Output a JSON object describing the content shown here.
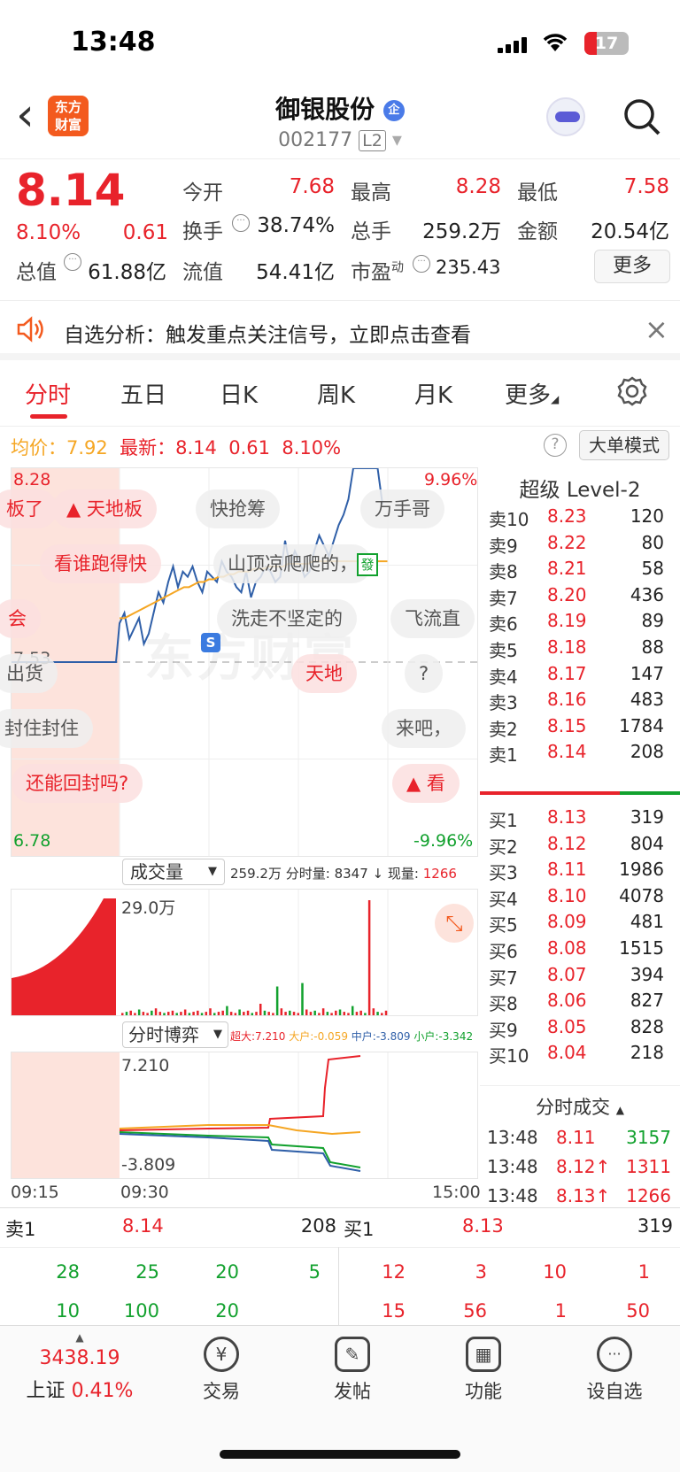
{
  "status": {
    "time": "13:48",
    "battery": "17"
  },
  "header": {
    "back": "‹",
    "logo_line1": "东方",
    "logo_line2": "财富",
    "title": "御银股份",
    "badge": "企",
    "code": "002177",
    "level": "L2",
    "dropdown": "▾"
  },
  "quote": {
    "price": "8.14",
    "pct": "8.10%",
    "chg": "0.61",
    "open_label": "今开",
    "open": "7.68",
    "high_label": "最高",
    "high": "8.28",
    "low_label": "最低",
    "low": "7.58",
    "turnover_label": "换手",
    "turnover": "38.74%",
    "vol_label": "总手",
    "vol": "259.2万",
    "amount_label": "金额",
    "amount": "20.54亿",
    "mcap_label": "总值",
    "mcap": "61.88亿",
    "float_label": "流值",
    "float": "54.41亿",
    "pe_label": "市盈",
    "pe_sup": "动",
    "pe": "235.43",
    "more": "更多"
  },
  "banner": {
    "text": "自选分析：触发重点关注信号，立即点击查看",
    "close": "×"
  },
  "tabs": [
    "分时",
    "五日",
    "日K",
    "周K",
    "月K",
    "更多"
  ],
  "chart": {
    "avg_label": "均价：",
    "avg": "7.92",
    "last_label": "最新：",
    "last": "8.14",
    "last_chg": "0.61",
    "last_pct": "8.10%",
    "mode": "大单模式",
    "help": "?",
    "y_top": "8.28",
    "y_mid": "7.53",
    "y_bot": "6.78",
    "pct_top": "9.96%",
    "pct_bot": "-9.96%",
    "watermark": "东方财富",
    "bubbles": [
      "板了",
      "天地板",
      "快抢筹",
      "万手哥",
      "看谁跑得快",
      "山顶凉爬爬的，",
      "会",
      "洗走不坚定的",
      "飞流直",
      "出货",
      "天地",
      "?",
      "封住封住",
      "来吧，",
      "还能回封吗?",
      "看"
    ],
    "fa": "發",
    "s_marker": "S"
  },
  "volume": {
    "selector": "成交量",
    "total": "259.2万",
    "min_label": "分时量:",
    "min_val": "8347",
    "arrow": "↓",
    "now_label": "现量:",
    "now_val": "1266",
    "scale": "29.0万"
  },
  "game": {
    "selector": "分时博弈",
    "super_label": "超大:",
    "super": "7.210",
    "big_label": "大户:",
    "big": "-0.059",
    "mid_label": "中户:",
    "mid": "-3.809",
    "small_label": "小户:",
    "small": "-3.342",
    "ytop": "7.210",
    "ybot": "-3.809"
  },
  "time_axis": [
    "09:15",
    "09:30",
    "15:00"
  ],
  "chart_data": {
    "type": "line",
    "title": "",
    "ylim": [
      6.78,
      8.28
    ],
    "prev_close": 7.53,
    "series": [
      {
        "name": "最新",
        "values": [
          7.53,
          7.53,
          7.53,
          7.53,
          7.53,
          7.53,
          7.53,
          7.53,
          7.53,
          7.53,
          7.53,
          7.53,
          7.53,
          7.53,
          7.53,
          7.53,
          7.53,
          7.53,
          7.53,
          7.53,
          7.53,
          7.53,
          7.53,
          7.68,
          7.72,
          7.62,
          7.66,
          7.7,
          7.6,
          7.64,
          7.72,
          7.8,
          7.76,
          7.84,
          7.9,
          7.82,
          7.88,
          7.86,
          7.9,
          7.84,
          7.8,
          7.88,
          7.86,
          7.84,
          7.92,
          7.88,
          7.86,
          7.82,
          7.8,
          7.88,
          7.78,
          7.84,
          7.86,
          7.9,
          7.88,
          7.84,
          7.86,
          8.0,
          7.9,
          7.96,
          7.92,
          7.86,
          7.88,
          7.96,
          8.02,
          7.98,
          7.94,
          8.0,
          8.06,
          8.1,
          8.16,
          8.28,
          8.28,
          8.28,
          8.28,
          8.28,
          8.28,
          8.14
        ]
      },
      {
        "name": "均价",
        "values": [
          7.7,
          7.7,
          7.71,
          7.72,
          7.73,
          7.74,
          7.75,
          7.76,
          7.77,
          7.78,
          7.79,
          7.8,
          7.81,
          7.82,
          7.82,
          7.83,
          7.84,
          7.84,
          7.85,
          7.85,
          7.86,
          7.86,
          7.87,
          7.87,
          7.88,
          7.88,
          7.88,
          7.89,
          7.89,
          7.89,
          7.9,
          7.9,
          7.9,
          7.9,
          7.91,
          7.91,
          7.91,
          7.91,
          7.91,
          7.92,
          7.92,
          7.92,
          7.92,
          7.92,
          7.92,
          7.92,
          7.92,
          7.92,
          7.92,
          7.92,
          7.92,
          7.92,
          7.92,
          7.92,
          7.92
        ]
      },
      {
        "name": "成交量",
        "values": [
          2,
          3,
          4,
          2,
          5,
          3,
          2,
          4,
          6,
          3,
          2,
          3,
          4,
          2,
          3,
          5,
          2,
          3,
          4,
          2,
          3,
          6,
          2,
          3,
          4,
          8,
          3,
          2,
          5,
          3,
          4,
          2,
          3,
          10,
          4,
          3,
          2,
          25,
          6,
          3,
          4,
          3,
          2,
          28,
          5,
          3,
          4,
          2,
          6,
          3,
          2,
          4,
          5,
          3,
          2,
          8,
          3,
          4,
          2,
          100,
          6,
          3,
          2,
          4
        ]
      }
    ]
  },
  "orderbook": {
    "title": "超级 Level-2",
    "sells": [
      {
        "label": "卖10",
        "price": "8.23",
        "vol": "120"
      },
      {
        "label": "卖9",
        "price": "8.22",
        "vol": "80"
      },
      {
        "label": "卖8",
        "price": "8.21",
        "vol": "58"
      },
      {
        "label": "卖7",
        "price": "8.20",
        "vol": "436"
      },
      {
        "label": "卖6",
        "price": "8.19",
        "vol": "89"
      },
      {
        "label": "卖5",
        "price": "8.18",
        "vol": "88"
      },
      {
        "label": "卖4",
        "price": "8.17",
        "vol": "147"
      },
      {
        "label": "卖3",
        "price": "8.16",
        "vol": "483"
      },
      {
        "label": "卖2",
        "price": "8.15",
        "vol": "1784"
      },
      {
        "label": "卖1",
        "price": "8.14",
        "vol": "208"
      }
    ],
    "buys": [
      {
        "label": "买1",
        "price": "8.13",
        "vol": "319"
      },
      {
        "label": "买2",
        "price": "8.12",
        "vol": "804"
      },
      {
        "label": "买3",
        "price": "8.11",
        "vol": "1986"
      },
      {
        "label": "买4",
        "price": "8.10",
        "vol": "4078"
      },
      {
        "label": "买5",
        "price": "8.09",
        "vol": "481"
      },
      {
        "label": "买6",
        "price": "8.08",
        "vol": "1515"
      },
      {
        "label": "买7",
        "price": "8.07",
        "vol": "394"
      },
      {
        "label": "买8",
        "price": "8.06",
        "vol": "827"
      },
      {
        "label": "买9",
        "price": "8.05",
        "vol": "828"
      },
      {
        "label": "买10",
        "price": "8.04",
        "vol": "218"
      }
    ],
    "ticks_title": "分时成交",
    "ticks": [
      {
        "time": "13:48",
        "price": "8.11",
        "vol": "3157"
      },
      {
        "time": "13:48",
        "price": "8.12↑",
        "vol": "1311"
      },
      {
        "time": "13:48",
        "price": "8.13↑",
        "vol": "1266"
      }
    ]
  },
  "queue": {
    "sell_label": "卖1",
    "sell_price": "8.14",
    "sell_vol": "208",
    "buy_label": "买1",
    "buy_price": "8.13",
    "buy_vol": "319",
    "sell_row1": [
      "28",
      "25",
      "20",
      "5"
    ],
    "sell_row2": [
      "10",
      "100",
      "20",
      ""
    ],
    "buy_row1": [
      "12",
      "3",
      "10",
      "1"
    ],
    "buy_row2": [
      "15",
      "56",
      "1",
      "50"
    ]
  },
  "nav": {
    "index_value": "3438.19",
    "index_name": "上证",
    "index_pct": "0.41%",
    "items": [
      {
        "label": "交易",
        "icon": "¥"
      },
      {
        "label": "发帖",
        "icon": "✎"
      },
      {
        "label": "功能",
        "icon": "▦"
      },
      {
        "label": "设自选",
        "icon": "···"
      }
    ]
  }
}
